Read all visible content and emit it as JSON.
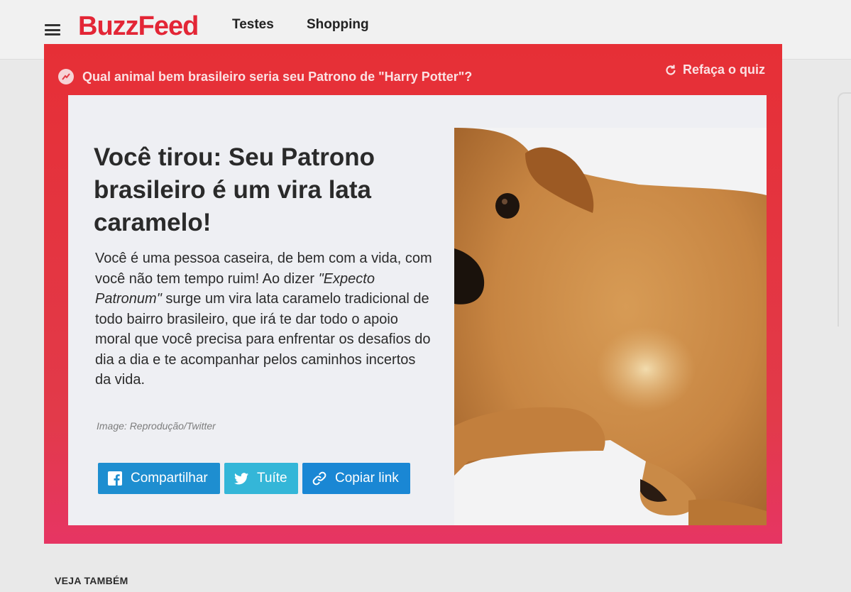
{
  "header": {
    "logo": "BuzzFeed",
    "nav": [
      "Testes",
      "Shopping"
    ]
  },
  "quiz": {
    "title": "Qual animal bem brasileiro seria seu Patrono de \"Harry Potter\"?",
    "redo_label": "Refaça o quiz",
    "result_heading": "Você tirou: Seu Patrono brasileiro é um vira lata caramelo!",
    "description_before": "Você é uma pessoa caseira, de bem com a vida, com você não tem tempo ruim! Ao dizer ",
    "description_italic": "\"Expecto Patronum\"",
    "description_after": " surge um vira lata caramelo tradicional de todo bairro brasileiro, que irá te dar todo o apoio moral que você precisa para enfrentar os desafios do dia a dia e te acompanhar pelos caminhos incertos da vida.",
    "image_credit": "Image: Reprodução/Twitter",
    "share": {
      "facebook_label": "Compartilhar",
      "twitter_label": "Tuíte",
      "copy_link_label": "Copiar link"
    }
  },
  "see_also": "VEJA TAMBÉM",
  "colors": {
    "brand": "#e32636",
    "quiz_border": "#e62f36",
    "facebook": "#1e8ed0",
    "twitter": "#34b6d8",
    "copy_link": "#1a87d4"
  },
  "icons": [
    "menu-icon",
    "trending-icon",
    "refresh-icon",
    "facebook-icon",
    "twitter-icon",
    "link-icon"
  ]
}
